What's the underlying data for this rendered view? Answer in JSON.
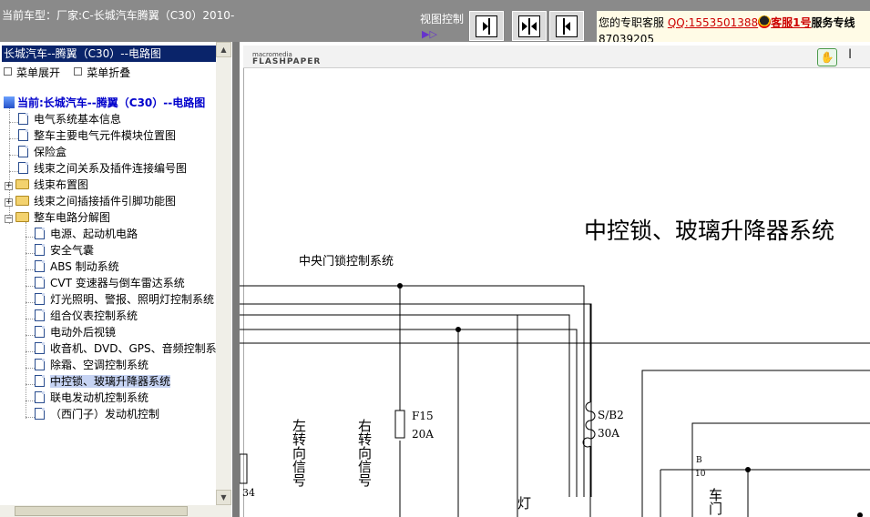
{
  "topbar": {
    "car_title": "当前车型：厂家:C-长城汽车腾翼（C30）2010-",
    "view_control_label": "视图控制",
    "view_arrow": "▶▷",
    "view_buttons": [
      "expand-right",
      "split",
      "expand-left"
    ]
  },
  "service": {
    "prefix": "您的专职客服",
    "qq": "QQ:1553501388",
    "kefu": "客服1号",
    "suffix": "服务专线",
    "phone": "87039205"
  },
  "left_panel": {
    "title": "长城汽车--腾翼（C30）--电路图",
    "expand_menu": "菜单展开",
    "collapse_menu": "菜单折叠",
    "root": "当前:长城汽车--腾翼（C30）--电路图",
    "items": [
      "电气系统基本信息",
      "整车主要电气元件模块位置图",
      "保险盒",
      "线束之间关系及插件连接编号图",
      "线束布置图",
      "线束之间插接插件引脚功能图",
      "整车电路分解图"
    ],
    "sub_items": [
      "电源、起动机电路",
      "安全气囊",
      "ABS 制动系统",
      "CVT 变速器与倒车雷达系统",
      "灯光照明、警报、照明灯控制系统",
      "组合仪表控制系统",
      "电动外后视镜",
      "收音机、DVD、GPS、音频控制系统",
      "除霜、空调控制系统",
      "中控锁、玻璃升降器系统",
      "联电发动机控制系统",
      "（西门子）发动机控制"
    ],
    "selected_item": "中控锁、玻璃升降器系统"
  },
  "flashpaper": {
    "brand_top": "macromedia",
    "brand_bottom": "FLASHPAPER",
    "hand_icon": "hand-tool-icon",
    "select_icon": "text-select-icon"
  },
  "diagram": {
    "title": "中控锁、玻璃升降器系统",
    "subsystem": "中央门锁控制系统",
    "fuse_label": "F15",
    "fuse_rating": "20A",
    "breaker_label": "S/B2",
    "breaker_rating": "30A",
    "left_turn": "左转向信号",
    "right_turn": "右转向信号",
    "lamp": "灯",
    "pin_b": "B",
    "pin_10": "10",
    "pin_34": "34",
    "vehicle_door": "车门"
  }
}
